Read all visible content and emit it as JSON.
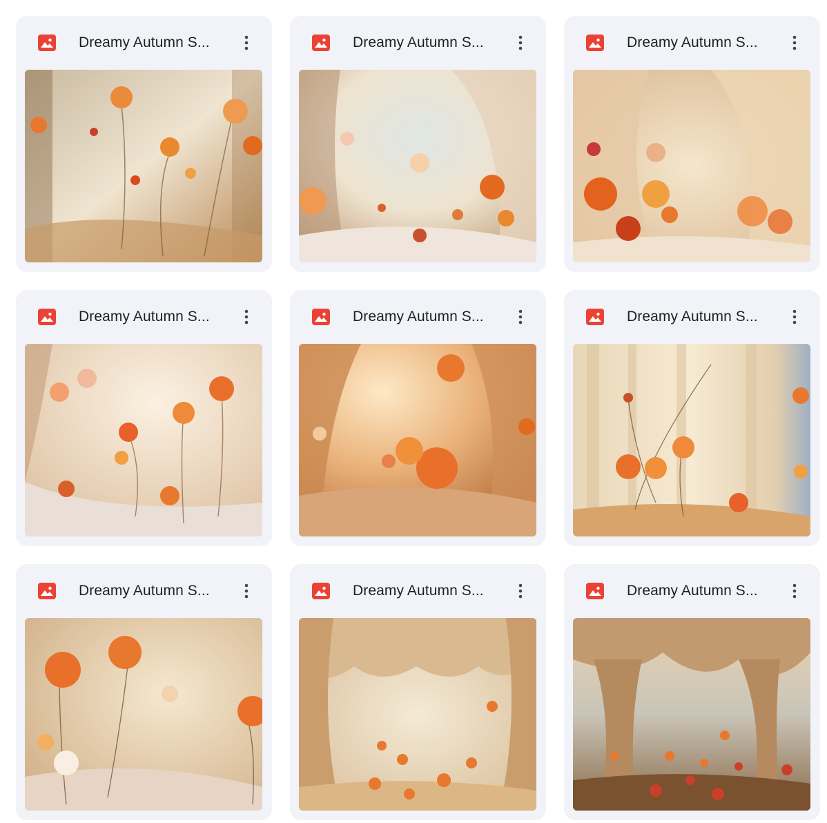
{
  "files": [
    {
      "name": "Dreamy Autumn S...",
      "icon": "image-file-icon",
      "thumbnail": "autumn-flowers-forest"
    },
    {
      "name": "Dreamy Autumn S...",
      "icon": "image-file-icon",
      "thumbnail": "autumn-flowers-meadow-drapes"
    },
    {
      "name": "Dreamy Autumn S...",
      "icon": "image-file-icon",
      "thumbnail": "autumn-flowers-curtain-stage"
    },
    {
      "name": "Dreamy Autumn S...",
      "icon": "image-file-icon",
      "thumbnail": "autumn-poppies-drapes"
    },
    {
      "name": "Dreamy Autumn S...",
      "icon": "image-file-icon",
      "thumbnail": "orange-poppies-silk"
    },
    {
      "name": "Dreamy Autumn S...",
      "icon": "image-file-icon",
      "thumbnail": "wildflowers-sheer-curtains"
    },
    {
      "name": "Dreamy Autumn S...",
      "icon": "image-file-icon",
      "thumbnail": "orange-peonies-fog"
    },
    {
      "name": "Dreamy Autumn S...",
      "icon": "image-file-icon",
      "thumbnail": "draped-canopy-meadow"
    },
    {
      "name": "Dreamy Autumn S...",
      "icon": "image-file-icon",
      "thumbnail": "canopy-tree-wildflowers"
    }
  ],
  "colors": {
    "card_bg": "#f1f3f8",
    "icon_red": "#ea4335",
    "title_text": "#1f1f1f",
    "more_dots": "#444746"
  }
}
